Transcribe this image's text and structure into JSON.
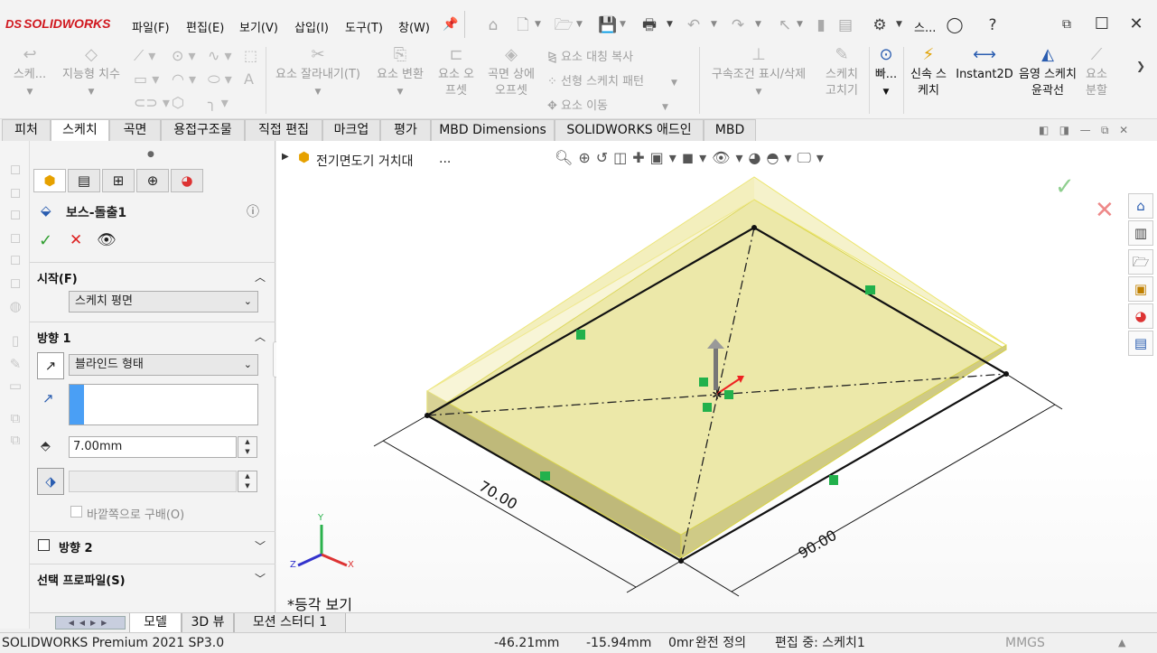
{
  "app": {
    "logo": "SOLIDWORKS",
    "logo_mark": "DS"
  },
  "menu": [
    "파일(F)",
    "편집(E)",
    "보기(V)",
    "삽입(I)",
    "도구(T)",
    "창(W)"
  ],
  "search_label": "스...",
  "commands": {
    "sketch": "스케...",
    "smart_dim": "지능형 치수",
    "trim": "요소 잘라내기(T)",
    "convert": "요소 변환",
    "offset": "요소 오프셋",
    "surface_offset": "곡면 상에 오프셋",
    "mirror": "요소 대칭 복사",
    "linear_pattern": "선형 스케치 패턴",
    "move": "요소 이동",
    "relations": "구속조건 표시/삭제",
    "repair": "스케치 고치기",
    "quick_snaps": "빠...",
    "rapid_sketch": "신속 스케치",
    "instant2d": "Instant2D",
    "shaded_contours": "음영 스케치 윤곽선",
    "split": "요소 분할"
  },
  "tabs": [
    "피처",
    "스케치",
    "곡면",
    "용접구조물",
    "직접 편집",
    "마크업",
    "평가",
    "MBD Dimensions",
    "SOLIDWORKS 애드인",
    "MBD"
  ],
  "active_tab": "스케치",
  "pm": {
    "title": "보스-돌출1",
    "from_label": "시작(F)",
    "from_value": "스케치 평면",
    "dir1_label": "방향 1",
    "dir1_type": "블라인드 형태",
    "depth": "7.00mm",
    "draft_outward": "바깥쪽으로 구배(O)",
    "dir2_label": "방향 2",
    "selected_contours": "선택 프로파일(S)"
  },
  "viewport": {
    "breadcrumb": "전기면도기 거치대",
    "breadcrumb_more": "...",
    "dim1": "70.00",
    "dim2": "90.00",
    "view_name": "*등각 보기",
    "triad": {
      "x": "X",
      "y": "Y",
      "z": "Z"
    }
  },
  "bottom_tabs": [
    "모델",
    "3D 뷰",
    "모션 스터디 1"
  ],
  "status": {
    "product": "SOLIDWORKS Premium 2021 SP3.0",
    "x": "-46.21mm",
    "y": "-15.94mm",
    "z": "0mm",
    "state": "완전 정의",
    "editing": "편집 중: 스케치1",
    "units": "MMGS"
  },
  "colors": {
    "accent": "#2a5db0",
    "logo": "#d0171e",
    "body": "#e9e49a",
    "confirm": "#2f9e2f",
    "cancel": "#d22"
  }
}
